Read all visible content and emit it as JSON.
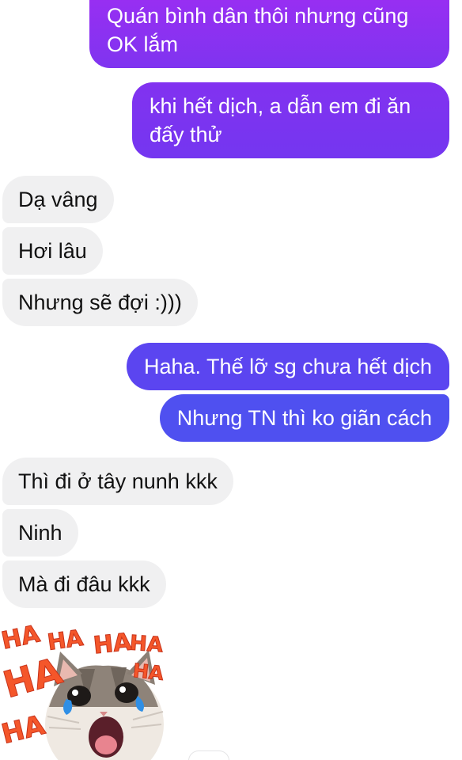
{
  "conversation": {
    "messages": [
      {
        "dir": "out",
        "text": "Quán bình dân thôi nhưng cũng OK lắm"
      },
      {
        "dir": "out",
        "text": "khi hết dịch, a dẫn em đi ăn đấy thử"
      },
      {
        "dir": "in",
        "text": "Dạ vâng"
      },
      {
        "dir": "in",
        "text": "Hơi lâu"
      },
      {
        "dir": "in",
        "text": "Nhưng sẽ đợi :)))"
      },
      {
        "dir": "out",
        "text": "Haha. Thế lỡ sg chưa hết dịch"
      },
      {
        "dir": "out",
        "text": "Nhưng TN thì ko giãn cách"
      },
      {
        "dir": "in",
        "text": "Thì đi ở tây nunh kkk"
      },
      {
        "dir": "in",
        "text": "Ninh"
      },
      {
        "dir": "in",
        "text": "Mà đi đâu kkk"
      }
    ],
    "sticker": {
      "name": "laughing-cat-sticker",
      "words": [
        "HA",
        "HA",
        "HA",
        "HA",
        "HA",
        "HA",
        "HA"
      ]
    }
  },
  "colors": {
    "incoming_bubble": "#f0f0f1",
    "outgoing_top": "#8a2cf0",
    "outgoing_mid": "#6a36f0",
    "outgoing_bottom": "#4f4ff0",
    "sticker_text": "#f4562a"
  }
}
